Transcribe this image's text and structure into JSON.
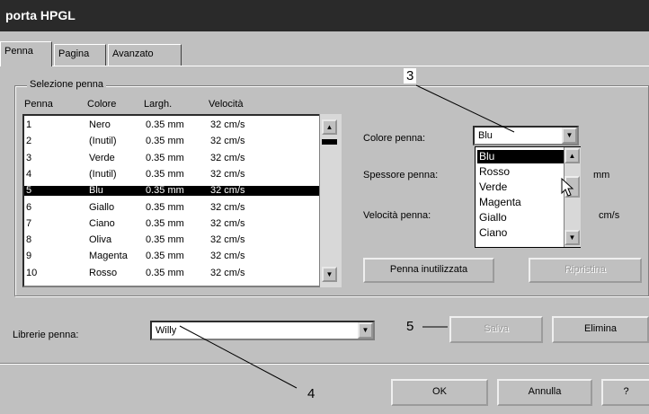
{
  "window": {
    "title": "porta HPGL"
  },
  "tabs": [
    {
      "label": "Penna",
      "active": true
    },
    {
      "label": "Pagina",
      "active": false
    },
    {
      "label": "Avanzato",
      "active": false
    }
  ],
  "pen_selection": {
    "group_label": "Selezione penna",
    "columns": [
      "Penna",
      "Colore",
      "Largh.",
      "Velocità"
    ],
    "rows": [
      {
        "pen": "1",
        "color": "Nero",
        "width": "0.35 mm",
        "speed": "32 cm/s"
      },
      {
        "pen": "2",
        "color": "(Inutil)",
        "width": "0.35 mm",
        "speed": "32 cm/s"
      },
      {
        "pen": "3",
        "color": "Verde",
        "width": "0.35 mm",
        "speed": "32 cm/s"
      },
      {
        "pen": "4",
        "color": "(Inutil)",
        "width": "0.35 mm",
        "speed": "32 cm/s"
      },
      {
        "pen": "5",
        "color": "Blu",
        "width": "0.35 mm",
        "speed": "32 cm/s",
        "selected": true
      },
      {
        "pen": "6",
        "color": "Giallo",
        "width": "0.35 mm",
        "speed": "32 cm/s"
      },
      {
        "pen": "7",
        "color": "Ciano",
        "width": "0.35 mm",
        "speed": "32 cm/s"
      },
      {
        "pen": "8",
        "color": "Oliva",
        "width": "0.35 mm",
        "speed": "32 cm/s"
      },
      {
        "pen": "9",
        "color": "Magenta",
        "width": "0.35 mm",
        "speed": "32 cm/s"
      },
      {
        "pen": "10",
        "color": "Rosso",
        "width": "0.35 mm",
        "speed": "32 cm/s"
      }
    ]
  },
  "pen_settings": {
    "color_label": "Colore penna:",
    "color_value": "Blu",
    "color_options": [
      "Blu",
      "Rosso",
      "Verde",
      "Magenta",
      "Giallo",
      "Ciano"
    ],
    "thickness_label": "Spessore penna:",
    "thickness_unit": "mm",
    "speed_label": "Velocità penna:",
    "speed_unit": "cm/s",
    "unused_pen_button": "Penna inutilizzata",
    "restore_button": "Ripristina"
  },
  "libraries": {
    "label": "Librerie penna:",
    "value": "Willy",
    "save_button": "Salva",
    "delete_button": "Elimina"
  },
  "footer": {
    "ok_button": "OK",
    "cancel_button": "Annulla",
    "help_button": "?"
  },
  "callouts": {
    "c3": "3",
    "c4": "4",
    "c5": "5"
  }
}
